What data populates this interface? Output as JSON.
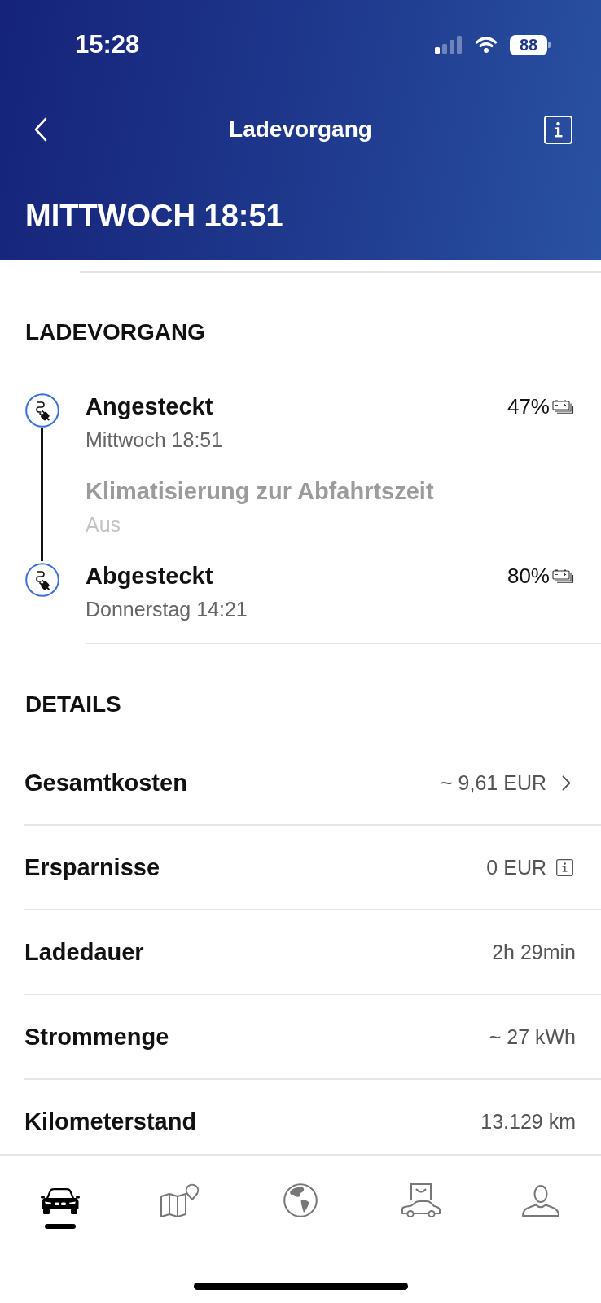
{
  "status_bar": {
    "time": "15:28",
    "battery": "88"
  },
  "nav_bar": {
    "title": "Ladevorgang"
  },
  "header": {
    "title": "MITTWOCH 18:51"
  },
  "charging": {
    "heading": "LADEVORGANG",
    "events": [
      {
        "kind": "plug",
        "title": "Angesteckt",
        "subtitle": "Mittwoch 18:51",
        "percent": "47%"
      },
      {
        "kind": "setting",
        "title": "Klimatisierung zur Abfahrtszeit",
        "subtitle": "Aus"
      },
      {
        "kind": "plug",
        "title": "Abgesteckt",
        "subtitle": "Donnerstag 14:21",
        "percent": "80%"
      }
    ]
  },
  "details": {
    "heading": "DETAILS",
    "rows": [
      {
        "kind": "link",
        "label": "Gesamtkosten",
        "value": "~ 9,61 EUR"
      },
      {
        "kind": "info",
        "label": "Ersparnisse",
        "value": "0 EUR"
      },
      {
        "kind": "plain",
        "label": "Ladedauer",
        "value": "2h 29min"
      },
      {
        "kind": "plain",
        "label": "Strommenge",
        "value": "~ 27 kWh"
      },
      {
        "kind": "plain",
        "label": "Kilometerstand",
        "value": "13.129 km"
      }
    ]
  },
  "tab_bar": {
    "tabs": [
      {
        "selected": true
      },
      {
        "selected": false
      },
      {
        "selected": false
      },
      {
        "selected": false
      },
      {
        "selected": false
      }
    ]
  }
}
